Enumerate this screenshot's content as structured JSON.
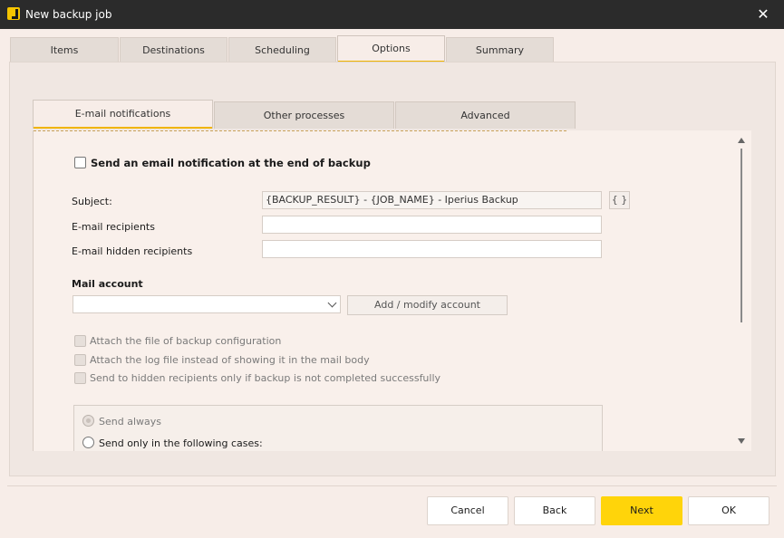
{
  "window": {
    "title": "New backup job",
    "close_glyph": "✕"
  },
  "main_tabs": [
    {
      "label": "Items"
    },
    {
      "label": "Destinations"
    },
    {
      "label": "Scheduling"
    },
    {
      "label": "Options"
    },
    {
      "label": "Summary"
    }
  ],
  "main_tabs_active": "Options",
  "sub_tabs": [
    {
      "label": "E-mail notifications"
    },
    {
      "label": "Other processes"
    },
    {
      "label": "Advanced"
    }
  ],
  "sub_tabs_active": "E-mail notifications",
  "email": {
    "send_notification_label": "Send an email notification at the end of backup",
    "send_notification_checked": false,
    "subject_label": "Subject:",
    "subject_value": "{BACKUP_RESULT} - {JOB_NAME} - Iperius Backup",
    "variables_button": "{ }",
    "recipients_label": "E-mail recipients",
    "recipients_value": "",
    "hidden_recipients_label": "E-mail hidden recipients",
    "hidden_recipients_value": "",
    "mail_account_heading": "Mail account",
    "mail_account_selected": "",
    "add_modify_account_button": "Add / modify account",
    "options": [
      {
        "label": "Attach the file of backup configuration",
        "checked": false,
        "enabled": false
      },
      {
        "label": "Attach the log file instead of showing it in the mail body",
        "checked": false,
        "enabled": false
      },
      {
        "label": "Send to hidden recipients only if backup is not completed successfully",
        "checked": false,
        "enabled": false
      }
    ],
    "send_mode": {
      "always_label": "Send always",
      "always_selected": true,
      "cases_label": "Send only in the following cases:",
      "cases_selected": false
    }
  },
  "footer": {
    "cancel": "Cancel",
    "back": "Back",
    "next": "Next",
    "ok": "OK"
  },
  "colors": {
    "accent": "#ffd40a",
    "titlebar": "#2b2b2b",
    "background": "#f7ede8"
  }
}
